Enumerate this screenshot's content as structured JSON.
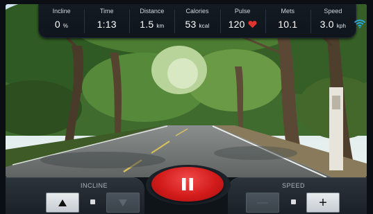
{
  "stats": [
    {
      "label": "Incline",
      "value": "0",
      "unit": "%"
    },
    {
      "label": "Time",
      "value": "1:13",
      "unit": ""
    },
    {
      "label": "Distance",
      "value": "1.5",
      "unit": "km"
    },
    {
      "label": "Calories",
      "value": "53",
      "unit": "kcal"
    },
    {
      "label": "Pulse",
      "value": "120",
      "unit": ""
    },
    {
      "label": "Mets",
      "value": "10.1",
      "unit": ""
    },
    {
      "label": "Speed",
      "value": "3.0",
      "unit": "kph"
    }
  ],
  "incline_panel": {
    "label": "INCLINE",
    "up_icon": "triangle-up",
    "down_icon": "triangle-down"
  },
  "speed_panel": {
    "label": "SPEED",
    "minus_label": "—",
    "plus_label": "+"
  },
  "pause": {
    "icon": "pause"
  },
  "colors": {
    "accent": "#d31b1b",
    "heart": "#e0342e"
  }
}
